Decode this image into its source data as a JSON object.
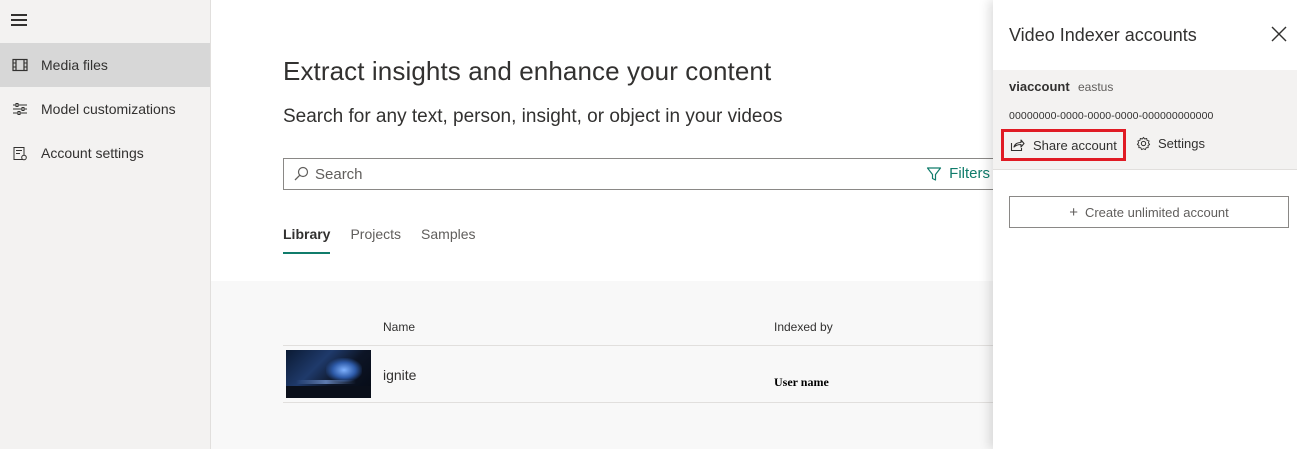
{
  "nav": {
    "items": [
      {
        "label": "Media files",
        "icon": "film-icon",
        "active": true
      },
      {
        "label": "Model customizations",
        "icon": "sliders-icon",
        "active": false
      },
      {
        "label": "Account settings",
        "icon": "account-settings-icon",
        "active": false
      }
    ]
  },
  "main": {
    "title": "Extract insights and enhance your content",
    "subtitle": "Search for any text, person, insight, or object in your videos",
    "search": {
      "placeholder": "Search"
    },
    "filters_label": "Filters",
    "tabs": [
      {
        "label": "Library",
        "active": true
      },
      {
        "label": "Projects",
        "active": false
      },
      {
        "label": "Samples",
        "active": false
      }
    ],
    "table": {
      "columns": [
        "Name",
        "Indexed by"
      ],
      "rows": [
        {
          "name": "ignite",
          "indexed_by": "User name"
        }
      ]
    }
  },
  "panel": {
    "title": "Video Indexer accounts",
    "account": {
      "name": "viaccount",
      "region": "eastus",
      "id": "00000000-0000-0000-0000-000000000000"
    },
    "share_label": "Share account",
    "settings_label": "Settings",
    "create_label": "Create unlimited account"
  },
  "colors": {
    "accent": "#107c6b",
    "highlight": "#e01b24",
    "nav_bg": "#f3f2f1",
    "nav_active_bg": "#d7d7d7"
  }
}
